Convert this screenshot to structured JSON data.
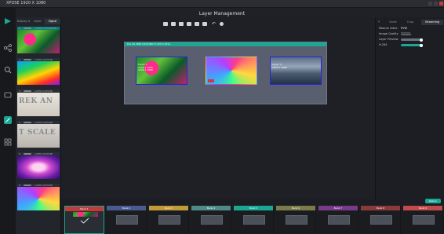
{
  "window": {
    "title": "XPOSE 1920 X 1080"
  },
  "header": {
    "title": "Layer Management"
  },
  "left_nav": {
    "icons": [
      "play-icon",
      "network-icon",
      "search-icon",
      "window-icon",
      "edit-icon",
      "grid-icon"
    ]
  },
  "layer_list": {
    "tabs": [
      "Display A",
      "Layer",
      "Signal"
    ],
    "items": [
      {
        "num": "1",
        "label": "LAYER 01/HDMI/5K",
        "thumb": "th-green",
        "selected": true
      },
      {
        "num": "2",
        "label": "LAYER 02/HDMI",
        "thumb": "th-rgb",
        "selected": false
      },
      {
        "num": "3",
        "label": "LAYER 03/HDMI",
        "thumb": "th-text",
        "overlay": "REK AN",
        "selected": false
      },
      {
        "num": "4",
        "label": "LAYER 04/HDMI",
        "thumb": "th-text2",
        "overlay": "T SCALE",
        "selected": false
      },
      {
        "num": "5",
        "label": "LAYER 05/HDMI",
        "thumb": "th-face",
        "selected": false
      },
      {
        "num": "6",
        "label": "LAYER 06/HDMI",
        "thumb": "th-psy",
        "selected": false
      }
    ]
  },
  "canvas": {
    "screen_label": "Pos 26 3840 (W)/1080 H (1th 0.19%)",
    "windows": [
      {
        "name": "window-1",
        "thumb": "th-green",
        "info": [
          "Input: 1",
          "1920 x 1080",
          "1920 x 1080"
        ]
      },
      {
        "name": "window-2",
        "thumb": "th-psy",
        "info": []
      },
      {
        "name": "window-3",
        "thumb": "w-sea",
        "info": [
          "Input: 3",
          "1920 x 1080"
        ]
      }
    ]
  },
  "right_panel": {
    "tabs": [
      "Scale",
      "Crop",
      "Streaming"
    ],
    "rows": [
      {
        "label": "Module Index",
        "value": "PVW"
      },
      {
        "label": "Image Quality",
        "value": "Standard"
      },
      {
        "label": "Layer Preview",
        "value": ""
      },
      {
        "label": "H.264",
        "value": ""
      }
    ],
    "return_label": "Return"
  },
  "banks": [
    {
      "label": "Bank 1",
      "color": "#c23a3a",
      "active": true
    },
    {
      "label": "Bank 2",
      "color": "#4b5a8e"
    },
    {
      "label": "Bank 3",
      "color": "#c29a3a"
    },
    {
      "label": "Bank 4",
      "color": "#4e8a8a"
    },
    {
      "label": "Bank 5",
      "color": "#1aa894"
    },
    {
      "label": "Bank 6",
      "color": "#7a7a4a"
    },
    {
      "label": "Bank 7",
      "color": "#7a3a8a"
    },
    {
      "label": "Bank 8",
      "color": "#8a3a3a"
    },
    {
      "label": "Bank 9",
      "color": "#c24a4a"
    }
  ],
  "toolbar": {
    "icons": [
      "layer-front-icon",
      "layer-back-icon",
      "layer-up-icon",
      "layer-down-icon",
      "copy-icon",
      "paste-icon",
      "undo-icon",
      "settings-icon"
    ]
  }
}
